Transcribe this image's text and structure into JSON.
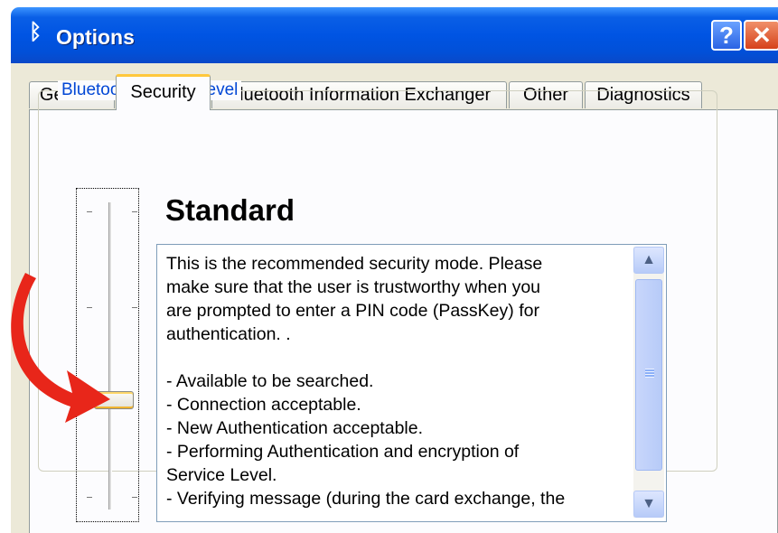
{
  "window": {
    "title": "Options",
    "app_icon": "bluetooth-icon",
    "help_label": "?",
    "close_label": "✕"
  },
  "tabs": [
    {
      "label": "General",
      "active": false
    },
    {
      "label": "Security",
      "active": true
    },
    {
      "label": "Bluetooth Information Exchanger",
      "active": false
    },
    {
      "label": "Other",
      "active": false
    },
    {
      "label": "Diagnostics",
      "active": false
    }
  ],
  "security": {
    "group_label": "Bluetooth security level",
    "level_name": "Standard",
    "slider_level": "3 of 4 (from top)",
    "description": "This is the recommended security mode. Please\nmake sure that the user is trustworthy when you\nare prompted to enter a PIN code (PassKey) for\nauthentication. .\n\n- Available to be searched.\n- Connection acceptable.\n- New Authentication acceptable.\n- Performing Authentication and encryption of\nService Level.\n- Verifying message (during the card exchange, the"
  },
  "colors": {
    "titlebar": "#0054e3",
    "group_label": "#0046d5",
    "arrow": "#e8261a",
    "active_tab_accent": "#ffc83c"
  }
}
